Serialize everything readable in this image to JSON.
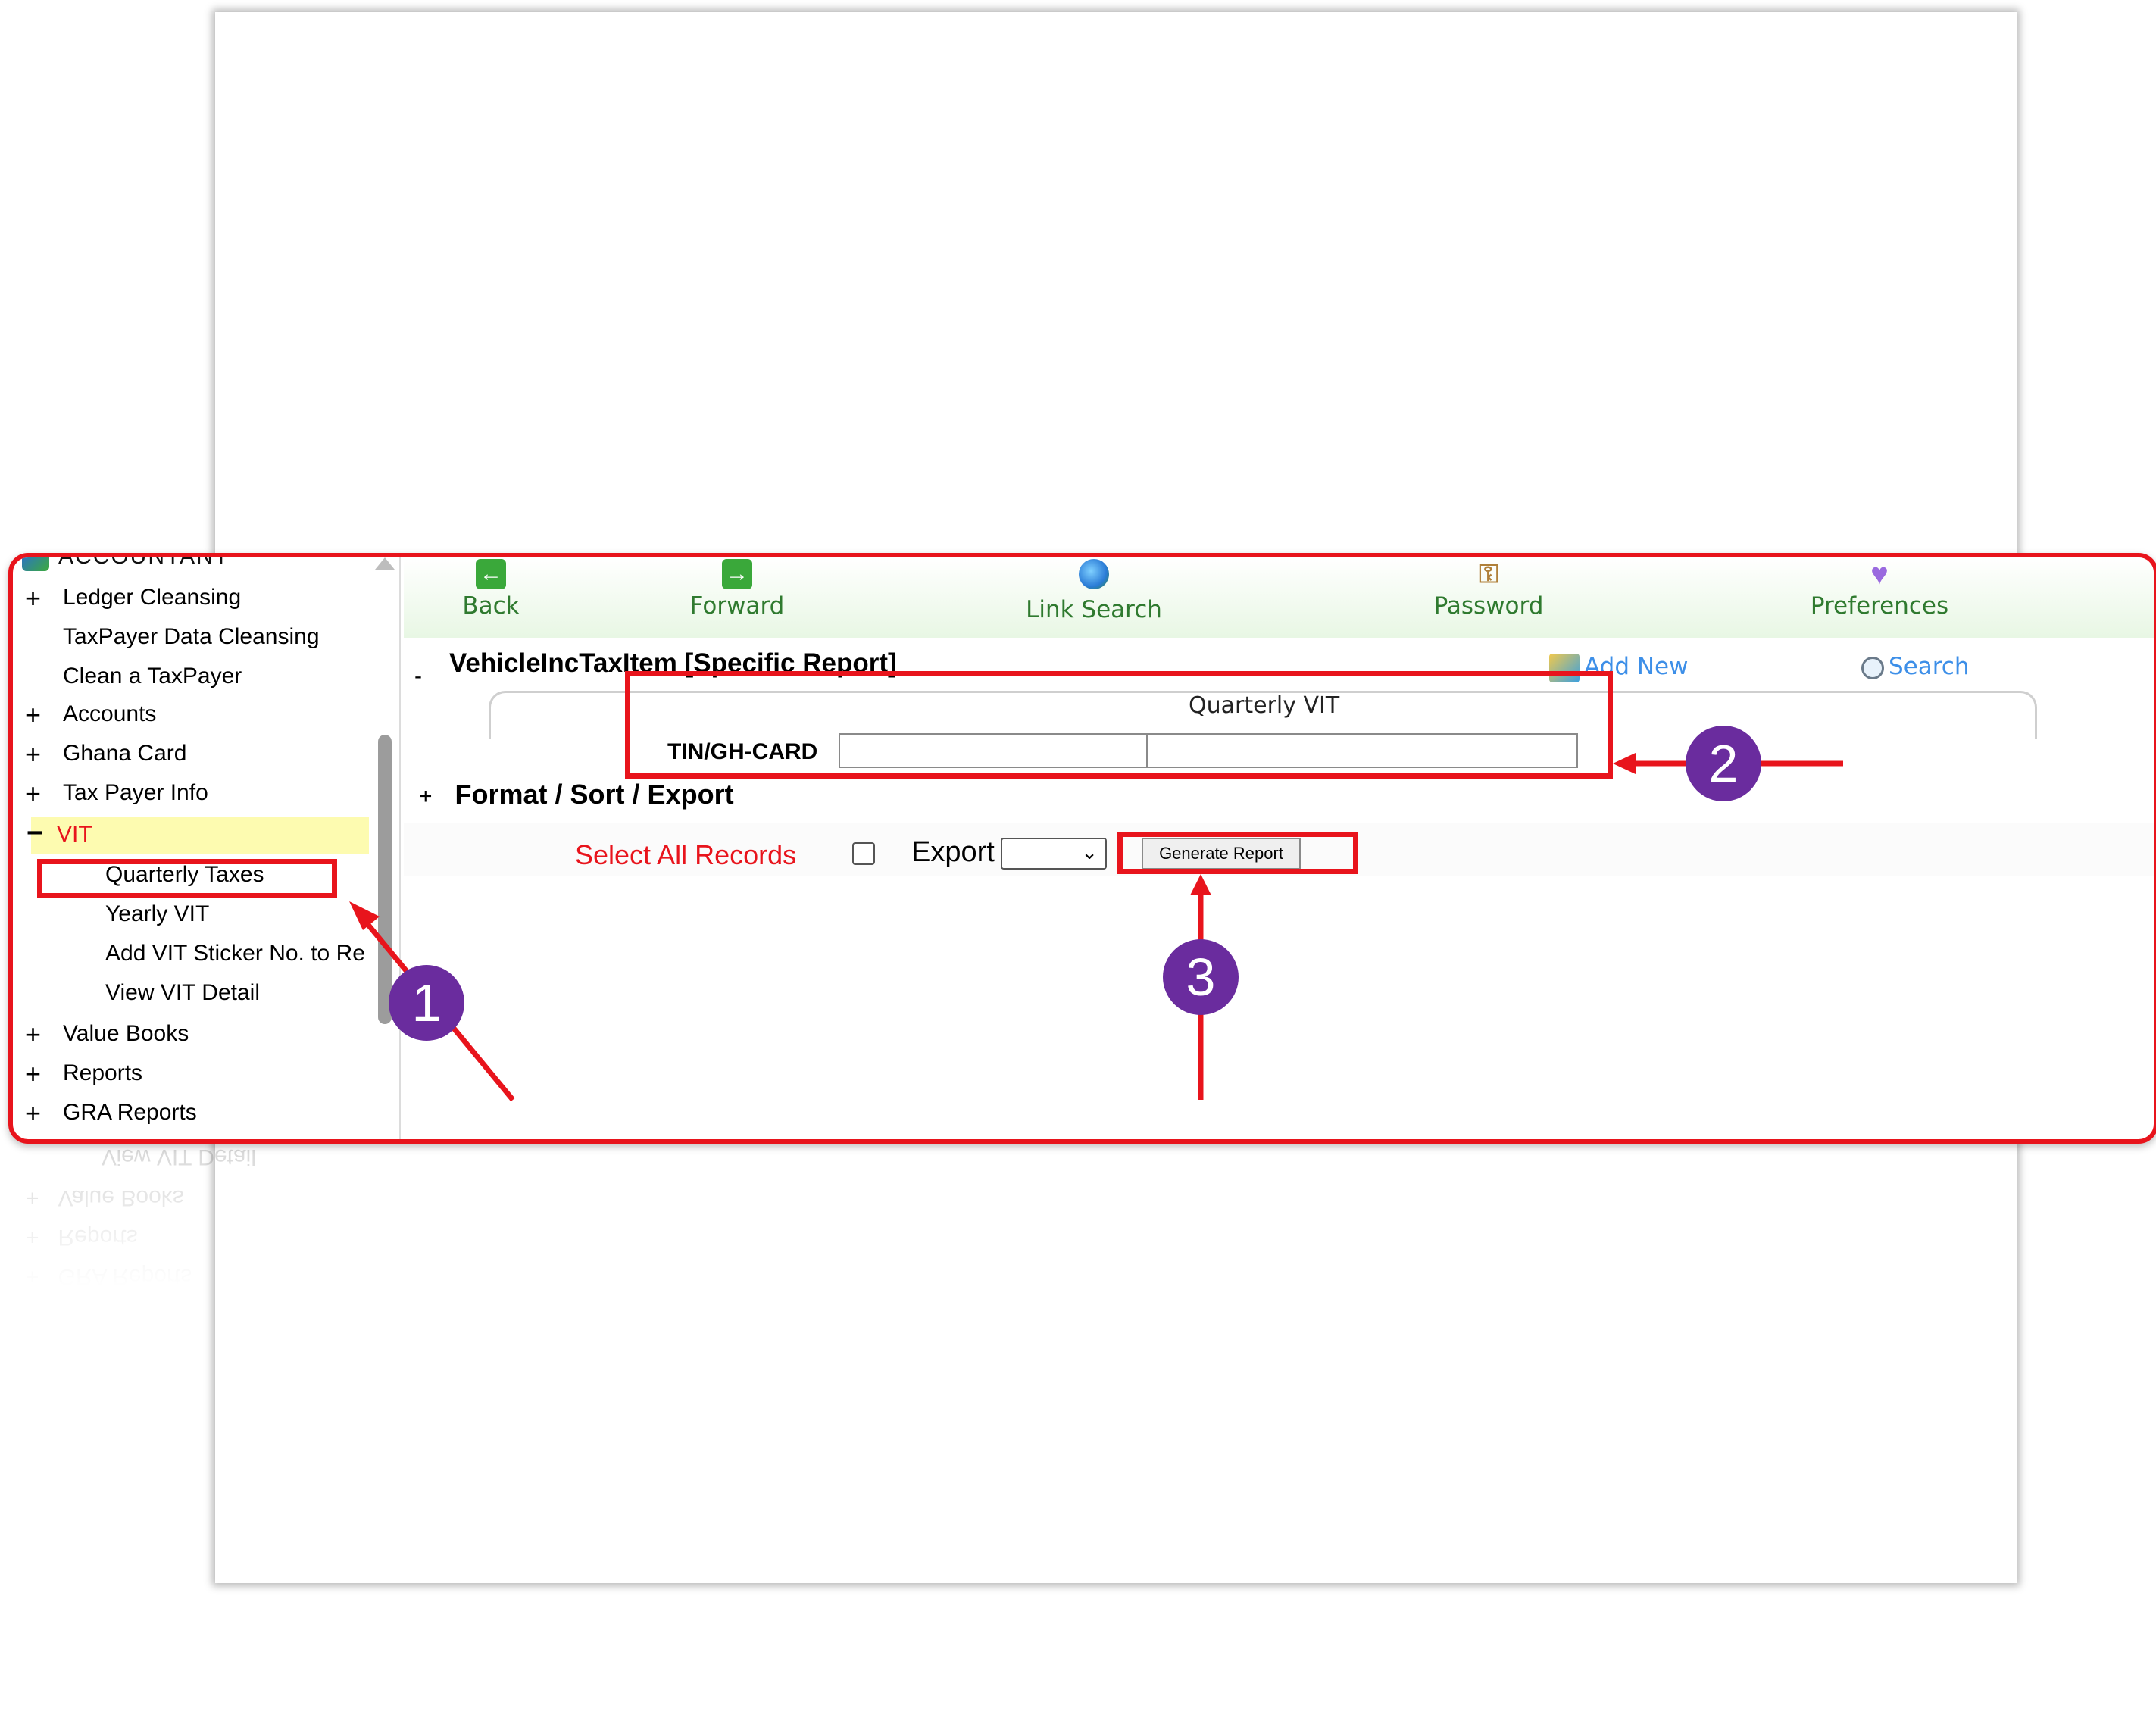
{
  "sidebar": {
    "header": "ACCOUNTANT",
    "items": [
      {
        "pm": "+",
        "label": "Ledger Cleansing"
      },
      {
        "pm": "",
        "label": "TaxPayer Data Cleansing"
      },
      {
        "pm": "",
        "label": "Clean a TaxPayer"
      },
      {
        "pm": "+",
        "label": "Accounts"
      },
      {
        "pm": "+",
        "label": "Ghana Card"
      },
      {
        "pm": "+",
        "label": "Tax Payer Info"
      }
    ],
    "vit": {
      "pm": "−",
      "label": "VIT"
    },
    "vit_sub": [
      "Quarterly Taxes",
      "Yearly VIT",
      "Add VIT Sticker No. to Re",
      "View VIT Detail"
    ],
    "items_after": [
      {
        "pm": "+",
        "label": "Value Books"
      },
      {
        "pm": "+",
        "label": "Reports"
      },
      {
        "pm": "+",
        "label": "GRA Reports"
      }
    ]
  },
  "toolbar": {
    "back": "Back",
    "forward": "Forward",
    "link_search": "Link Search",
    "password": "Password",
    "preferences": "Preferences"
  },
  "report": {
    "title": "VehicleIncTaxItem  [Specific Report]",
    "collapse": "-",
    "add_new": "Add New",
    "search": "Search",
    "fieldset_legend": "Quarterly VIT",
    "tin_label": "TIN/GH-CARD",
    "tin_value_1": "",
    "tin_value_2": ""
  },
  "format": {
    "toggle": "+",
    "title": "Format / Sort / Export",
    "select_all": "Select All Records",
    "export_label": "Export",
    "export_selected": "",
    "generate_button": "Generate Report"
  },
  "annotations": {
    "step1": "1",
    "step2": "2",
    "step3": "3"
  },
  "colors": {
    "highlight_red": "#e8141c",
    "badge_purple": "#6a2c9e",
    "toolbar_green": "#2f7a2f",
    "link_blue": "#3d8fe8",
    "vit_bg": "#fdfbb0"
  }
}
